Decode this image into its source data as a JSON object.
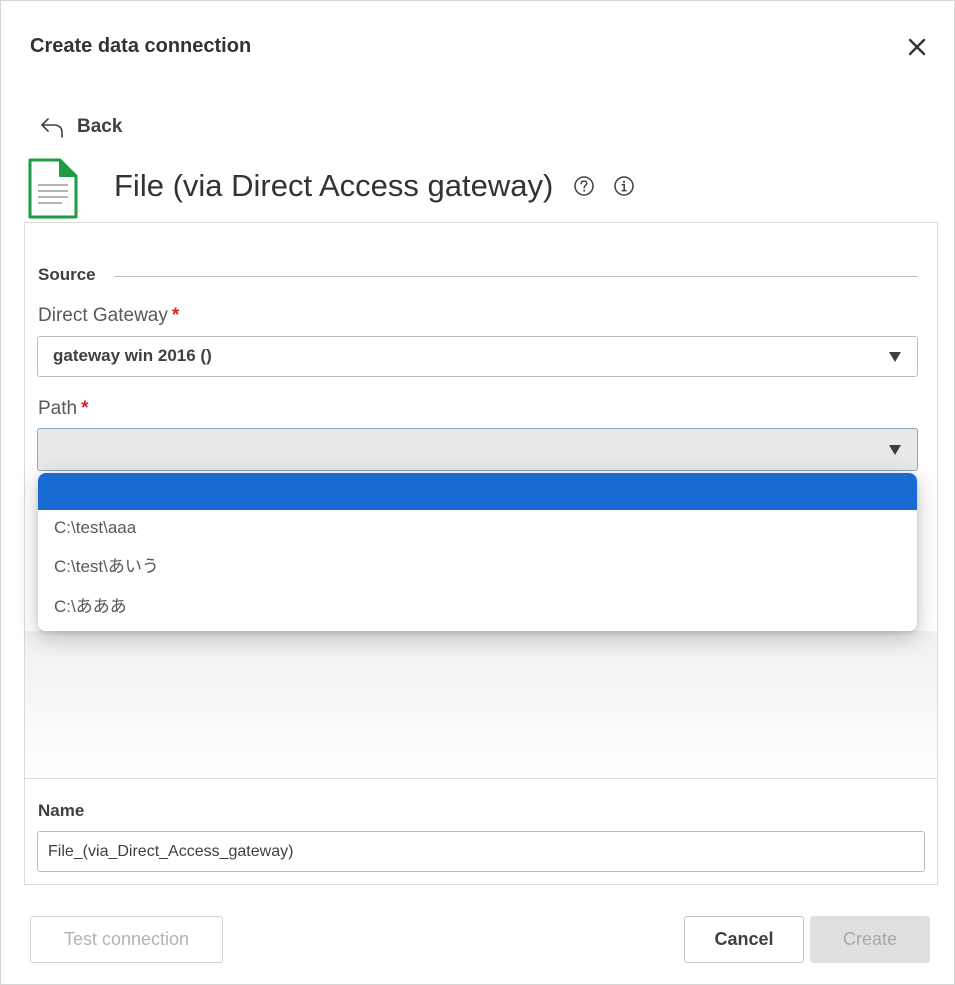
{
  "dialog": {
    "title": "Create data connection",
    "close_icon": "close-icon"
  },
  "back": {
    "label": "Back",
    "icon": "back-arrow-icon"
  },
  "connector": {
    "title": "File (via Direct Access gateway)",
    "icon": "file-document-icon",
    "icon_color": "#1e9b45",
    "help_icon": "help-circle-icon",
    "info_icon": "info-circle-icon"
  },
  "source": {
    "section_label": "Source",
    "direct_gateway": {
      "label": "Direct Gateway",
      "required_mark": "*",
      "value": "gateway win 2016 ()"
    },
    "path": {
      "label": "Path",
      "required_mark": "*",
      "value": "",
      "options": [
        "",
        "C:\\test\\aaa",
        "C:\\test\\あいう",
        "C:\\あああ"
      ],
      "highlighted_index": 0
    }
  },
  "name": {
    "label": "Name",
    "value": "File_(via_Direct_Access_gateway)"
  },
  "buttons": {
    "test_connection": "Test connection",
    "cancel": "Cancel",
    "create": "Create"
  },
  "colors": {
    "accent_blue": "#1a6ad3",
    "required_red": "#e02020",
    "icon_green": "#1e9b45"
  }
}
